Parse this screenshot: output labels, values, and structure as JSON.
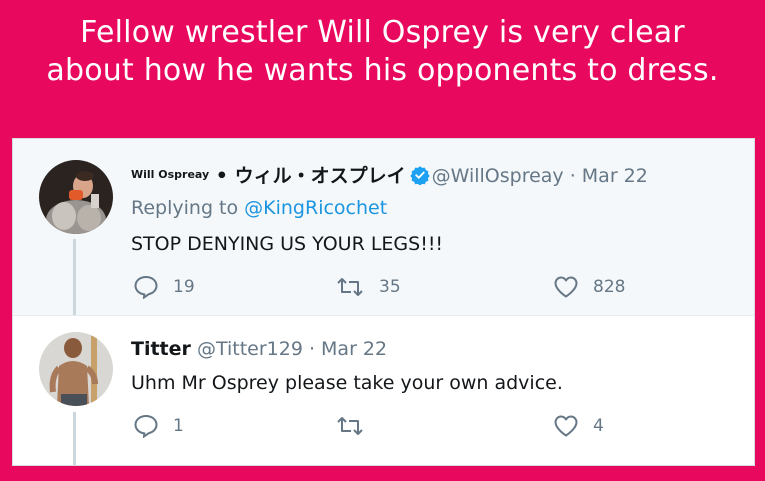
{
  "caption": {
    "line1": "Fellow wrestler Will Osprey is very clear",
    "line2": "about how he wants his opponents to dress."
  },
  "colors": {
    "background": "#e8095e",
    "link": "#1b95e0",
    "muted": "#657786",
    "verified": "#1da1f2"
  },
  "tweets": [
    {
      "display_name": "Will Ospreay",
      "separator": " • ",
      "display_name_jp": "ウィル・オスプレイ",
      "verified": true,
      "handle": "@WillOspreay",
      "date": " · Mar 22",
      "replying_prefix": "Replying to ",
      "replying_to": "@KingRicochet",
      "text": "STOP DENYING US YOUR LEGS!!!",
      "actions": {
        "reply_icon": "reply-icon",
        "reply_count": "19",
        "retweet_icon": "retweet-icon",
        "retweet_count": "35",
        "like_icon": "heart-icon",
        "like_count": "828"
      }
    },
    {
      "display_name": "Titter",
      "handle": "@Titter129",
      "date": " · Mar 22",
      "text": "Uhm Mr Osprey please take your own advice.",
      "actions": {
        "reply_icon": "reply-icon",
        "reply_count": "1",
        "retweet_icon": "retweet-icon",
        "retweet_count": "",
        "like_icon": "heart-icon",
        "like_count": "4"
      }
    }
  ]
}
